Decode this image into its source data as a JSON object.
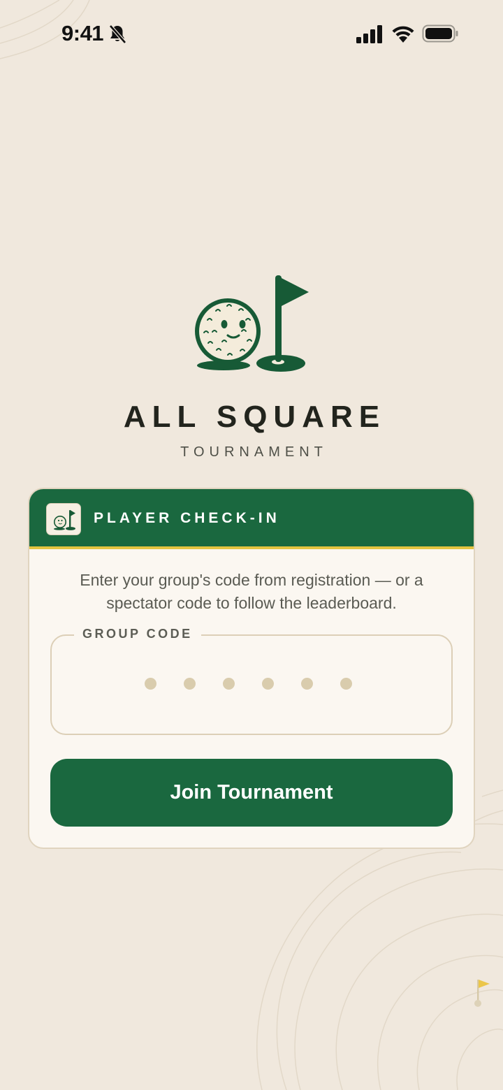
{
  "status_bar": {
    "time": "9:41",
    "icons": [
      "bell-muted-icon",
      "signal-icon",
      "wifi-icon",
      "battery-icon"
    ]
  },
  "brand": {
    "title": "ALL SQUARE",
    "subtitle": "TOURNAMENT",
    "logo_icon": "golf-ball-and-flag-icon"
  },
  "card": {
    "header_icon": "golf-ball-and-flag-icon",
    "header_title": "PLAYER CHECK-IN",
    "description": "Enter your group's code from registration — or a spectator code to follow the leaderboard.",
    "code_field": {
      "label": "GROUP CODE",
      "value": "",
      "placeholder_dots": 6
    },
    "join_button_label": "Join Tournament"
  },
  "colors": {
    "background": "#f0e8dd",
    "brand_green": "#1a683f",
    "accent_yellow": "#e4c440",
    "card_background": "#fbf7f1",
    "text_dark": "#22241d"
  }
}
